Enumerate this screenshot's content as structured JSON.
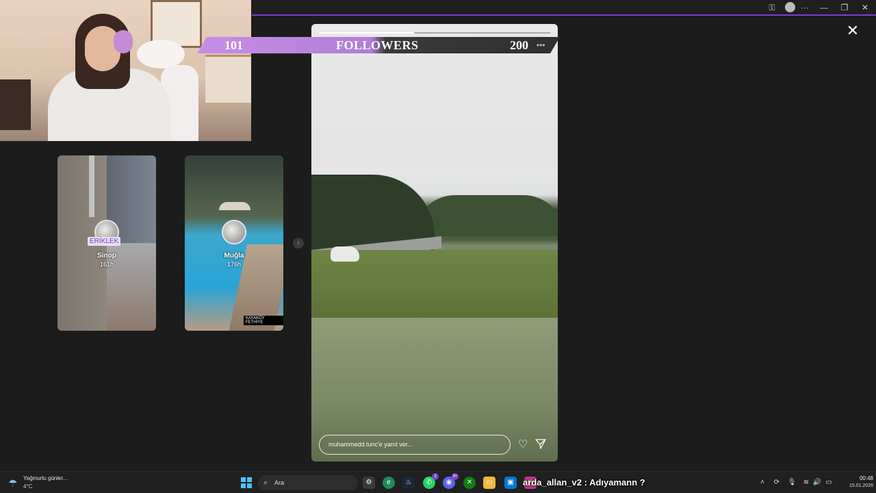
{
  "banner": {
    "current": "101",
    "label": "FOLLOWERS",
    "goal": "200"
  },
  "thumbnails": [
    {
      "title": "Sinop",
      "time": "161h",
      "sticker": "ERİKLEK"
    },
    {
      "title": "Muğla",
      "time": "176h",
      "location_tag": "KAYAKÖY FETHİYE"
    }
  ],
  "story": {
    "reply_placeholder": "muhammedd.tunc'e yanıt ver...",
    "progress": 0.41
  },
  "taskbar": {
    "weather_text": "Yağmurlu günler...",
    "weather_temp": "4°C",
    "search_placeholder": "Ara",
    "badges": {
      "whatsapp": "2",
      "discord": "9+"
    },
    "overlay_text": "arda_allan_v2 : Adıyamann ?",
    "time": "00:48",
    "date": "15.01.2026"
  },
  "colors": {
    "accent": "#7b3fc4",
    "banner_purple": "#c58ee6",
    "start_blue": "#4cc2ff"
  },
  "icons": [
    "key-icon",
    "user-icon",
    "more-icon",
    "minimize-icon",
    "maximize-icon",
    "close-icon",
    "heart-icon",
    "send-icon",
    "chevron-left-icon",
    "search-icon",
    "windows-start-icon",
    "weather-rain-icon"
  ]
}
